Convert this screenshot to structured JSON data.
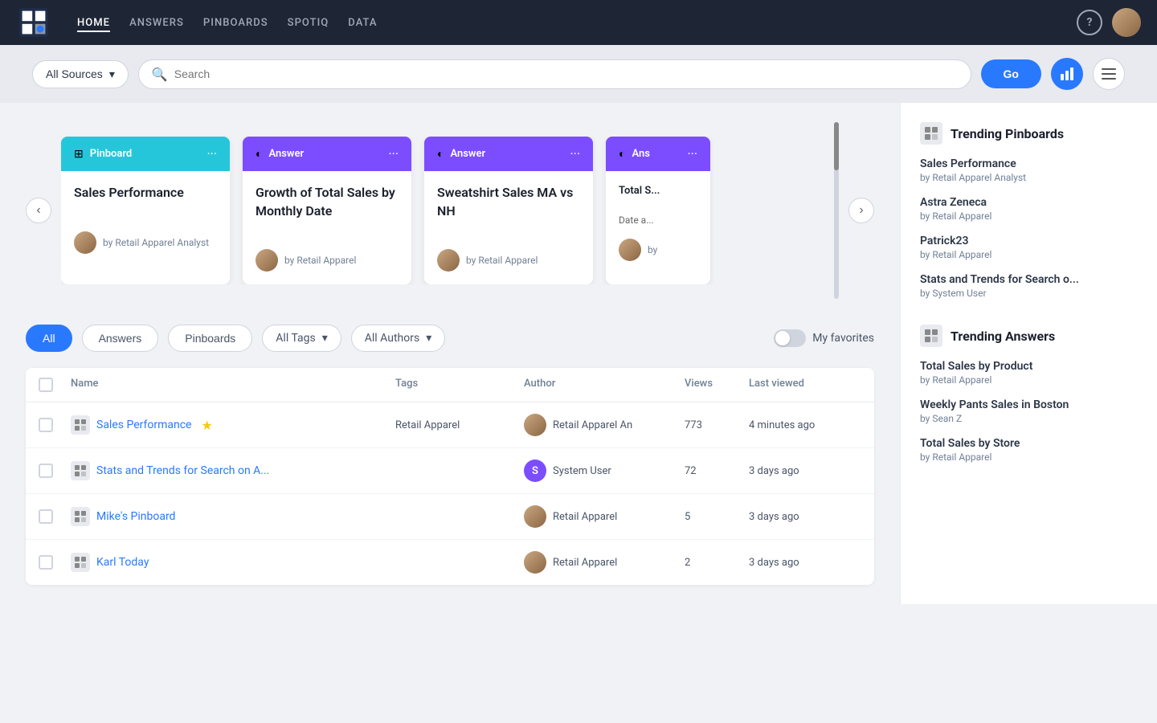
{
  "navbar": {
    "links": [
      {
        "label": "HOME",
        "active": true
      },
      {
        "label": "ANSWERS",
        "active": false
      },
      {
        "label": "PINBOARDS",
        "active": false
      },
      {
        "label": "SPOTIQ",
        "active": false
      },
      {
        "label": "DATA",
        "active": false
      }
    ],
    "help_label": "?",
    "chart_icon": "chart-bar"
  },
  "search": {
    "sources_label": "All Sources",
    "placeholder": "Search",
    "go_label": "Go"
  },
  "cards": [
    {
      "type_label": "Pinboard",
      "header_class": "pinboard",
      "title": "Sales Performance",
      "author": "by Retail Apparel Analyst",
      "dots": "···"
    },
    {
      "type_label": "Answer",
      "header_class": "answer",
      "title": "Growth of Total Sales by Monthly Date",
      "author": "by Retail Apparel",
      "dots": "···"
    },
    {
      "type_label": "Answer",
      "header_class": "answer2",
      "title": "Sweatshirt Sales MA vs NH",
      "author": "by Retail Apparel",
      "dots": "···"
    },
    {
      "type_label": "Ans",
      "header_class": "answer3",
      "title": "Total S... Date a...",
      "author": "by",
      "dots": "···",
      "clipped": true
    }
  ],
  "filters": {
    "tabs": [
      "All",
      "Answers",
      "Pinboards"
    ],
    "active_tab": "All",
    "tags_label": "All Tags",
    "authors_label": "All Authors",
    "favorites_label": "My favorites"
  },
  "table": {
    "headers": [
      "",
      "Name",
      "Tags",
      "Author",
      "Views",
      "Last viewed"
    ],
    "rows": [
      {
        "name": "Sales Performance",
        "starred": true,
        "tags": "Retail Apparel",
        "author_name": "Retail Apparel An",
        "author_type": "img",
        "views": "773",
        "last_viewed": "4 minutes ago"
      },
      {
        "name": "Stats and Trends for Search on A...",
        "starred": false,
        "tags": "",
        "author_name": "System User",
        "author_type": "initial",
        "author_initial": "S",
        "views": "72",
        "last_viewed": "3 days ago"
      },
      {
        "name": "Mike's Pinboard",
        "starred": false,
        "tags": "",
        "author_name": "Retail Apparel",
        "author_type": "img",
        "views": "5",
        "last_viewed": "3 days ago"
      },
      {
        "name": "Karl Today",
        "starred": false,
        "tags": "",
        "author_name": "Retail Apparel",
        "author_type": "img",
        "views": "2",
        "last_viewed": "3 days ago"
      }
    ]
  },
  "trending_pinboards": {
    "title": "Trending Pinboards",
    "items": [
      {
        "title": "Sales Performance",
        "sub": "by Retail Apparel Analyst"
      },
      {
        "title": "Astra Zeneca",
        "sub": "by Retail Apparel"
      },
      {
        "title": "Patrick23",
        "sub": "by Retail Apparel"
      },
      {
        "title": "Stats and Trends for Search o...",
        "sub": "by System User"
      }
    ]
  },
  "trending_answers": {
    "title": "Trending Answers",
    "items": [
      {
        "title": "Total Sales by Product",
        "sub": "by Retail Apparel"
      },
      {
        "title": "Weekly Pants Sales in Boston",
        "sub": "by Sean Z"
      },
      {
        "title": "Total Sales by Store",
        "sub": "by Retail Apparel"
      }
    ]
  }
}
